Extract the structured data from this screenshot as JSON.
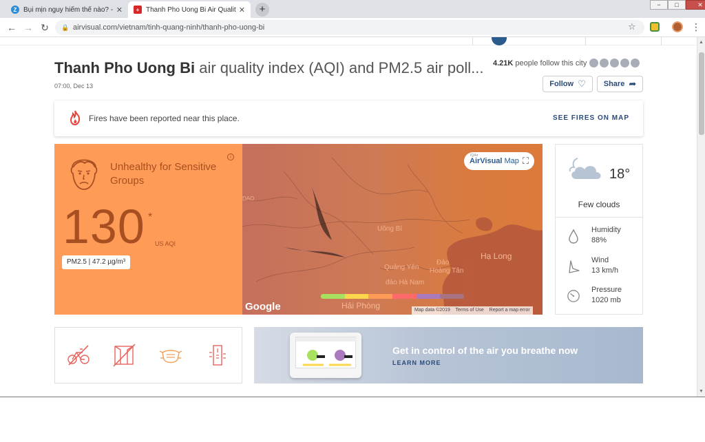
{
  "browser": {
    "tabs": [
      {
        "title": "Bụi mịn nguy hiểm thế nào? - Sứ",
        "favicon": "Z",
        "favicon_color": "#2d8cd6",
        "active": false
      },
      {
        "title": "Thanh Pho Uong Bi Air Quality In",
        "favicon": "+",
        "favicon_color": "#d62828",
        "active": true
      }
    ],
    "new_tab": "+",
    "url": "airvisual.com/vietnam/tinh-quang-ninh/thanh-pho-uong-bi",
    "window_controls": {
      "minimize": "−",
      "maximize": "□",
      "close": "✕"
    }
  },
  "header": {
    "city": "Thanh Pho Uong Bi",
    "title_rest": "air quality index (AQI) and PM2.5 air poll...",
    "updated": "07:00, Dec 13",
    "followers_count": "4.21K",
    "followers_text": "people follow this city",
    "follow_label": "Follow",
    "share_label": "Share"
  },
  "fires": {
    "message": "Fires have been reported near this place.",
    "link": "SEE FIRES ON MAP"
  },
  "aqi": {
    "level": "Unhealthy for Sensitive Groups",
    "value": "130",
    "asterisk": "*",
    "unit": "US AQI",
    "pm25": "PM2.5 | 47.2 µg/m³",
    "card_color": "#fe9b57",
    "text_color": "#a84f22"
  },
  "map": {
    "brand_prefix": "IQAir",
    "brand": "AirVisual",
    "brand_suffix": "Map",
    "places": [
      "Uông Bí",
      "Hạ Long",
      "Quảng Yên",
      "Đảo",
      "Hoàng Tân",
      "đảo Hà Nam",
      "Hải Phòng",
      "DAO"
    ],
    "attribution": [
      "Map data ©2019",
      "Terms of Use",
      "Report a map error"
    ],
    "google": "Google",
    "scale_colors": [
      "#a8e05f",
      "#fdd74b",
      "#fe9b57",
      "#fe6a69",
      "#a97abc",
      "#a87383"
    ]
  },
  "weather": {
    "temperature": "18°",
    "condition": "Few clouds",
    "humidity_label": "Humidity",
    "humidity": "88%",
    "wind_label": "Wind",
    "wind": "13 km/h",
    "pressure_label": "Pressure",
    "pressure": "1020 mb"
  },
  "promo": {
    "headline": "Get in control of the air you breathe now",
    "cta": "LEARN MORE"
  }
}
